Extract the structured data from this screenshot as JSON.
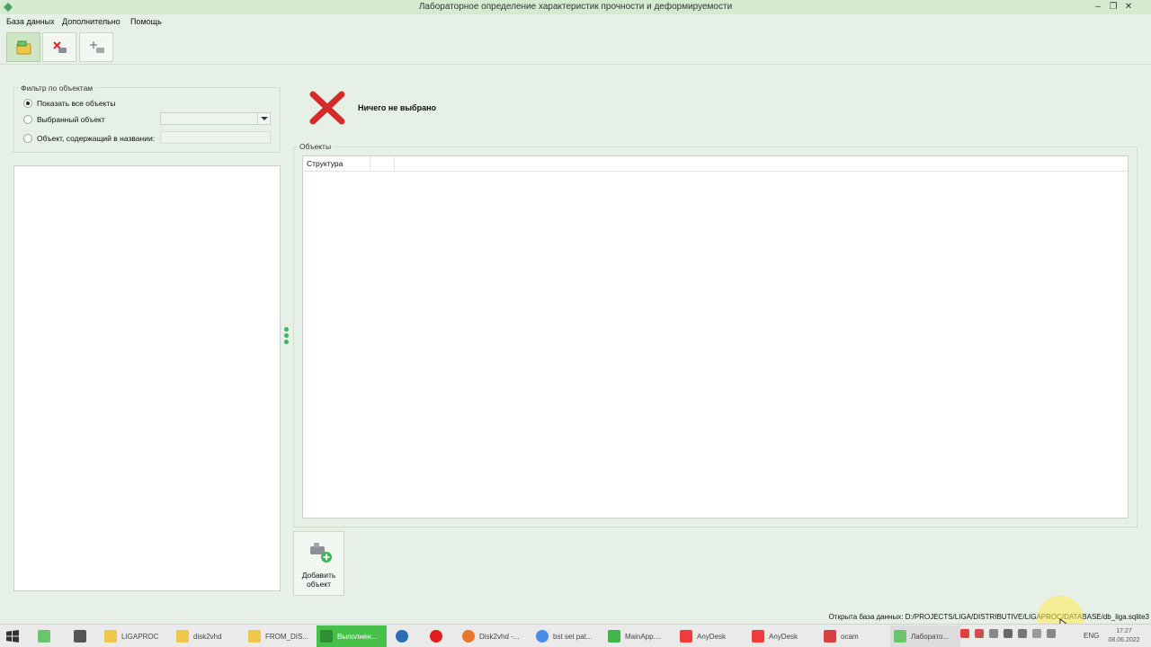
{
  "window": {
    "title": "Лабораторное определение характеристик прочности и деформируемости",
    "minimize": "–",
    "maximize": "❐",
    "close": "✕"
  },
  "menu": [
    "База данных",
    "Дополнительно",
    "Помощь"
  ],
  "filter": {
    "legend": "Фильтр по объектам",
    "show_all": "Показать все объекты",
    "selected_object": "Выбранный объект",
    "name_contains": "Объект, содержащий в названии:",
    "selected_value": "",
    "name_value": ""
  },
  "selection": {
    "label": "Ничего не выбрано"
  },
  "objects": {
    "legend": "Объекты",
    "columns": [
      "Структура",
      ""
    ]
  },
  "add_button": {
    "line1": "Добавить",
    "line2": "объект"
  },
  "status": {
    "text": "Открыта база данных: D:/PROJECTS/LIGA/DISTRIBUTIVE/LIGAPROC/DATABASE/db_liga.sqlite3"
  },
  "colors": {
    "accent_green": "#3cb55a",
    "delete_red": "#d42a2a",
    "title_bg": "#d4ebcf"
  },
  "taskbar": {
    "items": [
      {
        "label": "LIGAPROC",
        "icon": "folder-icon"
      },
      {
        "label": "disk2vhd",
        "icon": "folder-icon"
      },
      {
        "label": "FROM_DIS...",
        "icon": "folder-icon"
      },
      {
        "label": "Выполнен...",
        "icon": "app-icon"
      },
      {
        "label": "Disk2vhd -...",
        "icon": "firefox-icon"
      },
      {
        "label": "bst set pat...",
        "icon": "chrome-icon"
      },
      {
        "label": "MainApp....",
        "icon": "qt-icon"
      },
      {
        "label": "AnyDesk",
        "icon": "anydesk-icon"
      },
      {
        "label": "AnyDesk",
        "icon": "anydesk-icon"
      },
      {
        "label": "ocam",
        "icon": "ocam-icon"
      },
      {
        "label": "Лаборато...",
        "icon": "app-icon"
      }
    ],
    "lang": "ENG",
    "time": "17:27",
    "date": "08.06.2022"
  }
}
